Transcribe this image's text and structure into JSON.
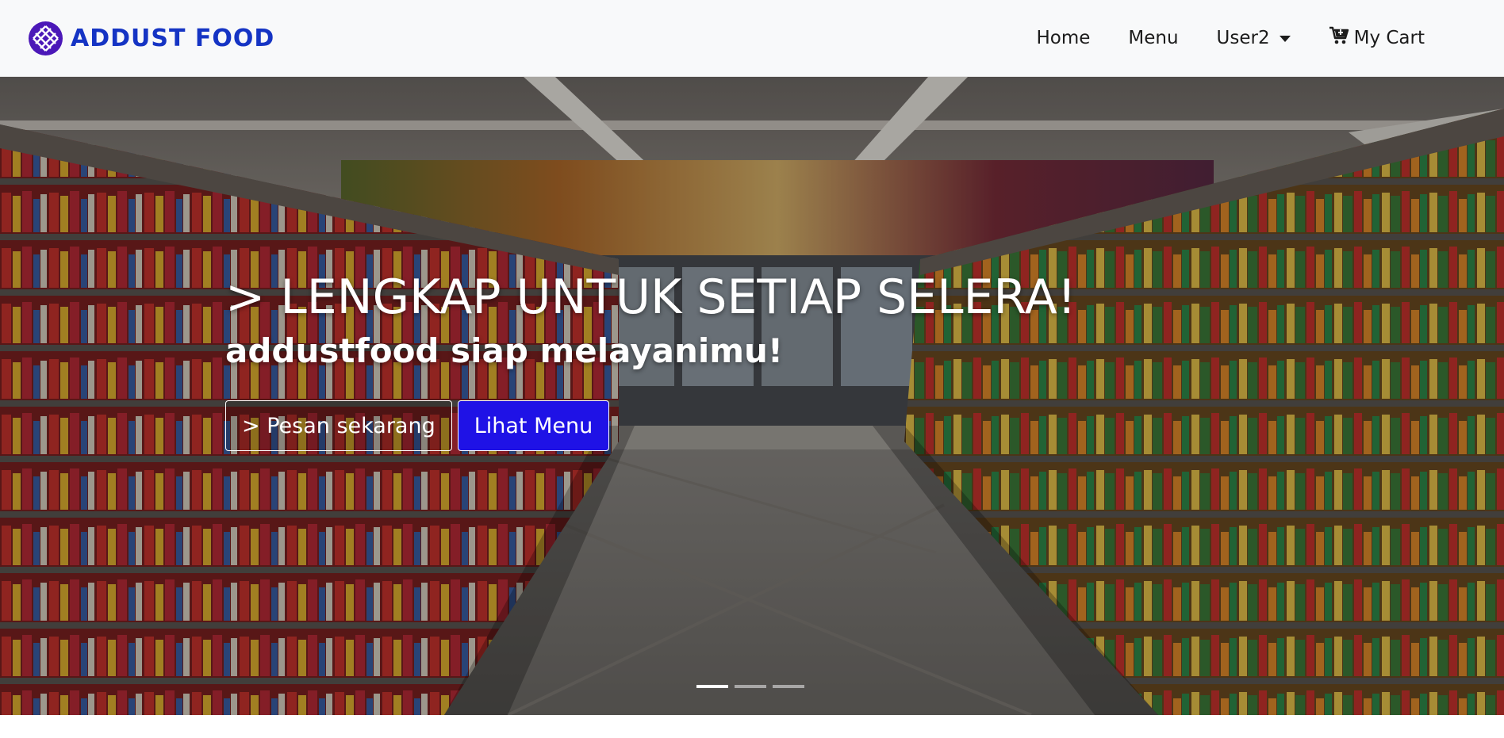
{
  "brand": {
    "name": "ADDUST FOOD",
    "logo_icon": "grid-globe-icon",
    "color": "#1534c4"
  },
  "nav": {
    "home": "Home",
    "menu": "Menu",
    "user": "User2",
    "cart": "My Cart"
  },
  "hero": {
    "title": "> LENGKAP UNTUK SETIAP SELERA!",
    "subtitle": "addustfood siap melayanimu!",
    "btn_order": "> Pesan sekarang",
    "btn_menu": "Lihat Menu",
    "btn_menu_color": "#1f12e6",
    "slides_total": 3,
    "active_slide": 1
  }
}
